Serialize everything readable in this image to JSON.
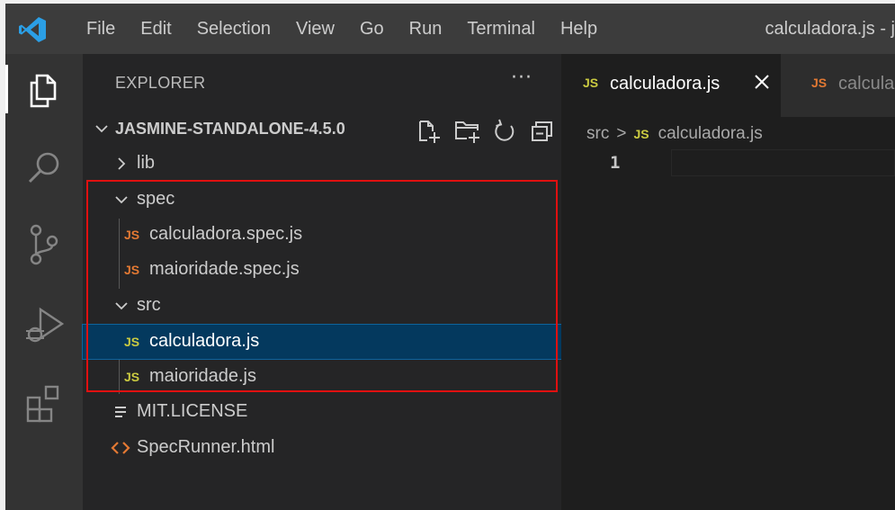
{
  "colors": {
    "js_yellow": "#cbcb41",
    "js_orange": "#e37933",
    "html_orange": "#e37933",
    "selection": "#04395e",
    "highlight_box": "#e01010"
  },
  "menu": [
    "File",
    "Edit",
    "Selection",
    "View",
    "Go",
    "Run",
    "Terminal",
    "Help"
  ],
  "window_title": "calculadora.js - j",
  "activity_bar": [
    "files-icon",
    "search-icon",
    "source-control-icon",
    "run-debug-icon",
    "extensions-icon"
  ],
  "sidebar": {
    "title": "EXPLORER",
    "more": "···",
    "folder": "JASMINE-STANDALONE-4.5.0",
    "header_actions": [
      "new-file-icon",
      "new-folder-icon",
      "refresh-icon",
      "collapse-all-icon"
    ],
    "tree": [
      {
        "label": "lib",
        "type": "folder",
        "expanded": false
      },
      {
        "label": "spec",
        "type": "folder",
        "expanded": true
      },
      {
        "label": "calculadora.spec.js",
        "type": "js",
        "badge": "JS"
      },
      {
        "label": "maioridade.spec.js",
        "type": "js",
        "badge": "JS"
      },
      {
        "label": "src",
        "type": "folder",
        "expanded": true
      },
      {
        "label": "calculadora.js",
        "type": "js",
        "badge": "JS",
        "selected": true
      },
      {
        "label": "maioridade.js",
        "type": "js",
        "badge": "JS"
      },
      {
        "label": "MIT.LICENSE",
        "type": "text"
      },
      {
        "label": "SpecRunner.html",
        "type": "html"
      }
    ]
  },
  "editor": {
    "tabs": [
      {
        "badge": "JS",
        "label": "calculadora.js",
        "active": true
      },
      {
        "badge": "JS",
        "label": "calcula",
        "active": false
      }
    ],
    "breadcrumb": {
      "folder": "src",
      "sep": ">",
      "badge": "JS",
      "file": "calculadora.js"
    },
    "line_number": "1"
  }
}
